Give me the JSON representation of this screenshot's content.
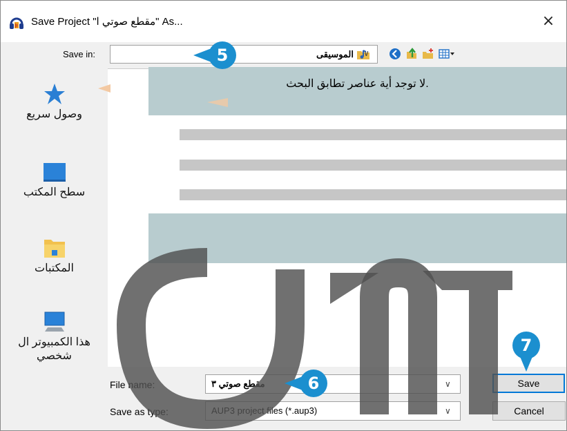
{
  "window": {
    "title": "Save Project \"مقطع صوتي ا\" As...",
    "close_label": "×"
  },
  "toolbar": {
    "save_in_label": "Save in:",
    "save_in_value": "الموسيقى",
    "dropdown_arrow": "∨"
  },
  "sidebar": {
    "items": [
      {
        "label": "وصول سريع",
        "icon": "star-icon"
      },
      {
        "label": "سطح المكتب",
        "icon": "desktop-icon"
      },
      {
        "label": "المكتبات",
        "icon": "libraries-folder-icon"
      },
      {
        "label": "هذا الكمبيوتر ال شخصي",
        "icon": "computer-icon"
      },
      {
        "label": "",
        "icon": "network-icon"
      }
    ]
  },
  "file_list": {
    "empty_message": ".لا توجد أية عناصر تطابق البحث"
  },
  "bottom": {
    "file_name_label": "File name:",
    "file_name_value": "مقطع صوتي ٣",
    "save_as_type_label": "Save as type:",
    "save_as_type_value": "AUP3 project files (*.aup3)",
    "save_button": "Save",
    "cancel_button": "Cancel"
  },
  "callouts": {
    "step5": "5",
    "step6": "6",
    "step7": "7"
  },
  "colors": {
    "callout_blue": "#1b8fcf",
    "banner_teal": "#b8cccf",
    "dialog_gray": "#f0f0f0",
    "default_button_border": "#0078d7"
  }
}
